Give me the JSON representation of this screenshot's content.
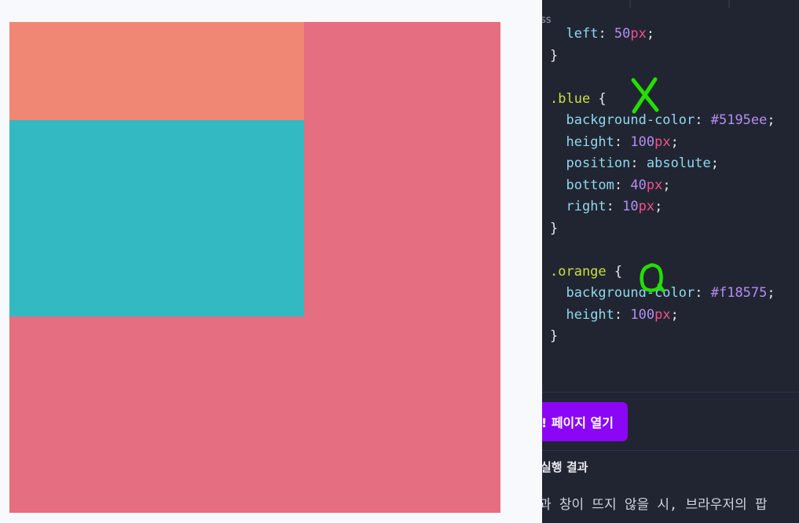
{
  "preview": {
    "colors": {
      "red_box": "#e56e80",
      "orange_box": "#f08775",
      "cyan_box": "#33b9c2"
    }
  },
  "editor": {
    "tab_label": "ss",
    "code_lines": [
      {
        "parts": [
          {
            "t": "  ",
            "c": "c-brace"
          },
          {
            "t": "left",
            "c": "c-prop"
          },
          {
            "t": ": ",
            "c": "c-brace"
          },
          {
            "t": "50",
            "c": "c-num"
          },
          {
            "t": "px",
            "c": "c-unit"
          },
          {
            "t": ";",
            "c": "c-brace"
          }
        ]
      },
      {
        "parts": [
          {
            "t": "}",
            "c": "c-brace"
          }
        ]
      },
      {
        "parts": []
      },
      {
        "parts": [
          {
            "t": ".blue",
            "c": "c-sel"
          },
          {
            "t": " {",
            "c": "c-brace"
          }
        ]
      },
      {
        "parts": [
          {
            "t": "  ",
            "c": "c-brace"
          },
          {
            "t": "background-color",
            "c": "c-prop"
          },
          {
            "t": ": ",
            "c": "c-brace"
          },
          {
            "t": "#5195ee",
            "c": "c-hex"
          },
          {
            "t": ";",
            "c": "c-brace"
          }
        ]
      },
      {
        "parts": [
          {
            "t": "  ",
            "c": "c-brace"
          },
          {
            "t": "height",
            "c": "c-prop"
          },
          {
            "t": ": ",
            "c": "c-brace"
          },
          {
            "t": "100",
            "c": "c-num"
          },
          {
            "t": "px",
            "c": "c-unit"
          },
          {
            "t": ";",
            "c": "c-brace"
          }
        ]
      },
      {
        "parts": [
          {
            "t": "  ",
            "c": "c-brace"
          },
          {
            "t": "position",
            "c": "c-prop"
          },
          {
            "t": ": ",
            "c": "c-brace"
          },
          {
            "t": "absolute",
            "c": "c-val"
          },
          {
            "t": ";",
            "c": "c-brace"
          }
        ]
      },
      {
        "parts": [
          {
            "t": "  ",
            "c": "c-brace"
          },
          {
            "t": "bottom",
            "c": "c-prop"
          },
          {
            "t": ": ",
            "c": "c-brace"
          },
          {
            "t": "40",
            "c": "c-num"
          },
          {
            "t": "px",
            "c": "c-unit"
          },
          {
            "t": ";",
            "c": "c-brace"
          }
        ]
      },
      {
        "parts": [
          {
            "t": "  ",
            "c": "c-brace"
          },
          {
            "t": "right",
            "c": "c-prop"
          },
          {
            "t": ": ",
            "c": "c-brace"
          },
          {
            "t": "10",
            "c": "c-num"
          },
          {
            "t": "px",
            "c": "c-unit"
          },
          {
            "t": ";",
            "c": "c-brace"
          }
        ]
      },
      {
        "parts": [
          {
            "t": "}",
            "c": "c-brace"
          }
        ]
      },
      {
        "parts": []
      },
      {
        "parts": [
          {
            "t": ".orange",
            "c": "c-sel"
          },
          {
            "t": " {",
            "c": "c-brace"
          }
        ]
      },
      {
        "parts": [
          {
            "t": "  ",
            "c": "c-brace"
          },
          {
            "t": "background-color",
            "c": "c-prop"
          },
          {
            "t": ": ",
            "c": "c-brace"
          },
          {
            "t": "#f18575",
            "c": "c-hex"
          },
          {
            "t": ";",
            "c": "c-brace"
          }
        ]
      },
      {
        "parts": [
          {
            "t": "  ",
            "c": "c-brace"
          },
          {
            "t": "height",
            "c": "c-prop"
          },
          {
            "t": ": ",
            "c": "c-brace"
          },
          {
            "t": "100",
            "c": "c-num"
          },
          {
            "t": "px",
            "c": "c-unit"
          },
          {
            "t": ";",
            "c": "c-brace"
          }
        ]
      },
      {
        "parts": [
          {
            "t": "}",
            "c": "c-brace"
          }
        ]
      }
    ],
    "annotations": [
      {
        "name": "x-mark-annotation",
        "symbol": "X",
        "color": "#22e000"
      },
      {
        "name": "o-mark-annotation",
        "symbol": "O",
        "color": "#22e000"
      }
    ]
  },
  "actions": {
    "open_page_label": "! 페이지 열기",
    "result_label": "실행 결과",
    "note": "과 창이 뜨지 않을 시, 브라우저의 팝"
  }
}
